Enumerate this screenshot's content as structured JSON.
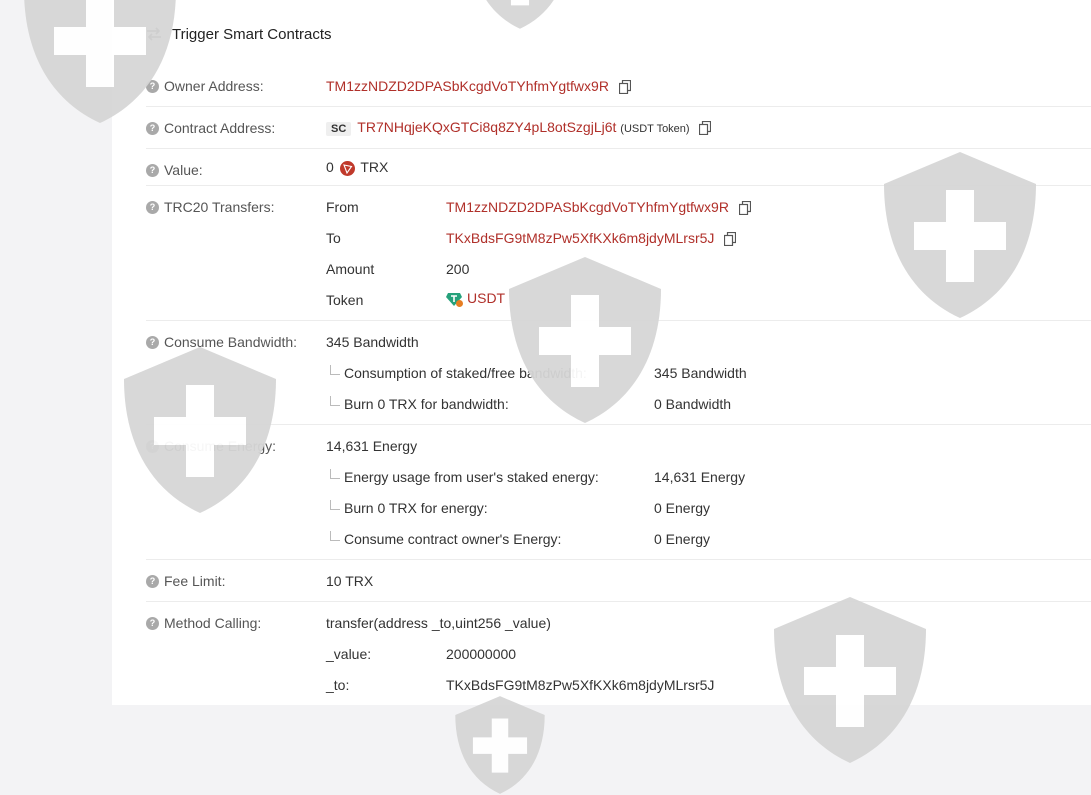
{
  "header": {
    "title": "Trigger Smart Contracts"
  },
  "owner": {
    "label": "Owner Address:",
    "address": "TM1zzNDZD2DPASbKcgdVoTYhfmYgtfwx9R"
  },
  "contract": {
    "label": "Contract Address:",
    "badge": "SC",
    "address": "TR7NHqjeKQxGTCi8q8ZY4pL8otSzgjLj6t",
    "tag": "(USDT Token)"
  },
  "value": {
    "label": "Value:",
    "amount": "0",
    "unit": "TRX"
  },
  "transfers": {
    "label": "TRC20 Transfers:",
    "from_label": "From",
    "from": "TM1zzNDZD2DPASbKcgdVoTYhfmYgtfwx9R",
    "to_label": "To",
    "to": "TKxBdsFG9tM8zPw5XfKXk6m8jdyMLrsr5J",
    "amount_label": "Amount",
    "amount": "200",
    "token_label": "Token",
    "token": "USDT"
  },
  "bandwidth": {
    "label": "Consume Bandwidth:",
    "total": "345 Bandwidth",
    "items": [
      {
        "label": "Consumption of staked/free bandwidth:",
        "value": "345 Bandwidth"
      },
      {
        "label": "Burn 0 TRX for bandwidth:",
        "value": "0 Bandwidth"
      }
    ]
  },
  "energy": {
    "label": "Consume Energy:",
    "total": "14,631 Energy",
    "items": [
      {
        "label": "Energy usage from user's staked energy:",
        "value": "14,631 Energy"
      },
      {
        "label": "Burn 0 TRX for energy:",
        "value": "0 Energy"
      },
      {
        "label": "Consume contract owner's Energy:",
        "value": "0 Energy"
      }
    ]
  },
  "fee": {
    "label": "Fee Limit:",
    "value": "10 TRX"
  },
  "method": {
    "label": "Method Calling:",
    "signature": "transfer(address _to,uint256 _value)",
    "params": [
      {
        "name": "_value:",
        "value": "200000000"
      },
      {
        "name": "_to:",
        "value": "TKxBdsFG9tM8zPw5XfKXk6m8jdyMLrsr5J"
      }
    ]
  },
  "icons": {
    "help": "question-circle-icon",
    "copy": "copy-icon",
    "swap": "swap-arrows-icon",
    "trx": "tron-logo-icon",
    "usdt": "usdt-token-icon",
    "watermark": "shield-cross-icon"
  },
  "colors": {
    "link": "#b0302a",
    "background": "#f3f3f5",
    "watermark": "#d6d6d6"
  }
}
